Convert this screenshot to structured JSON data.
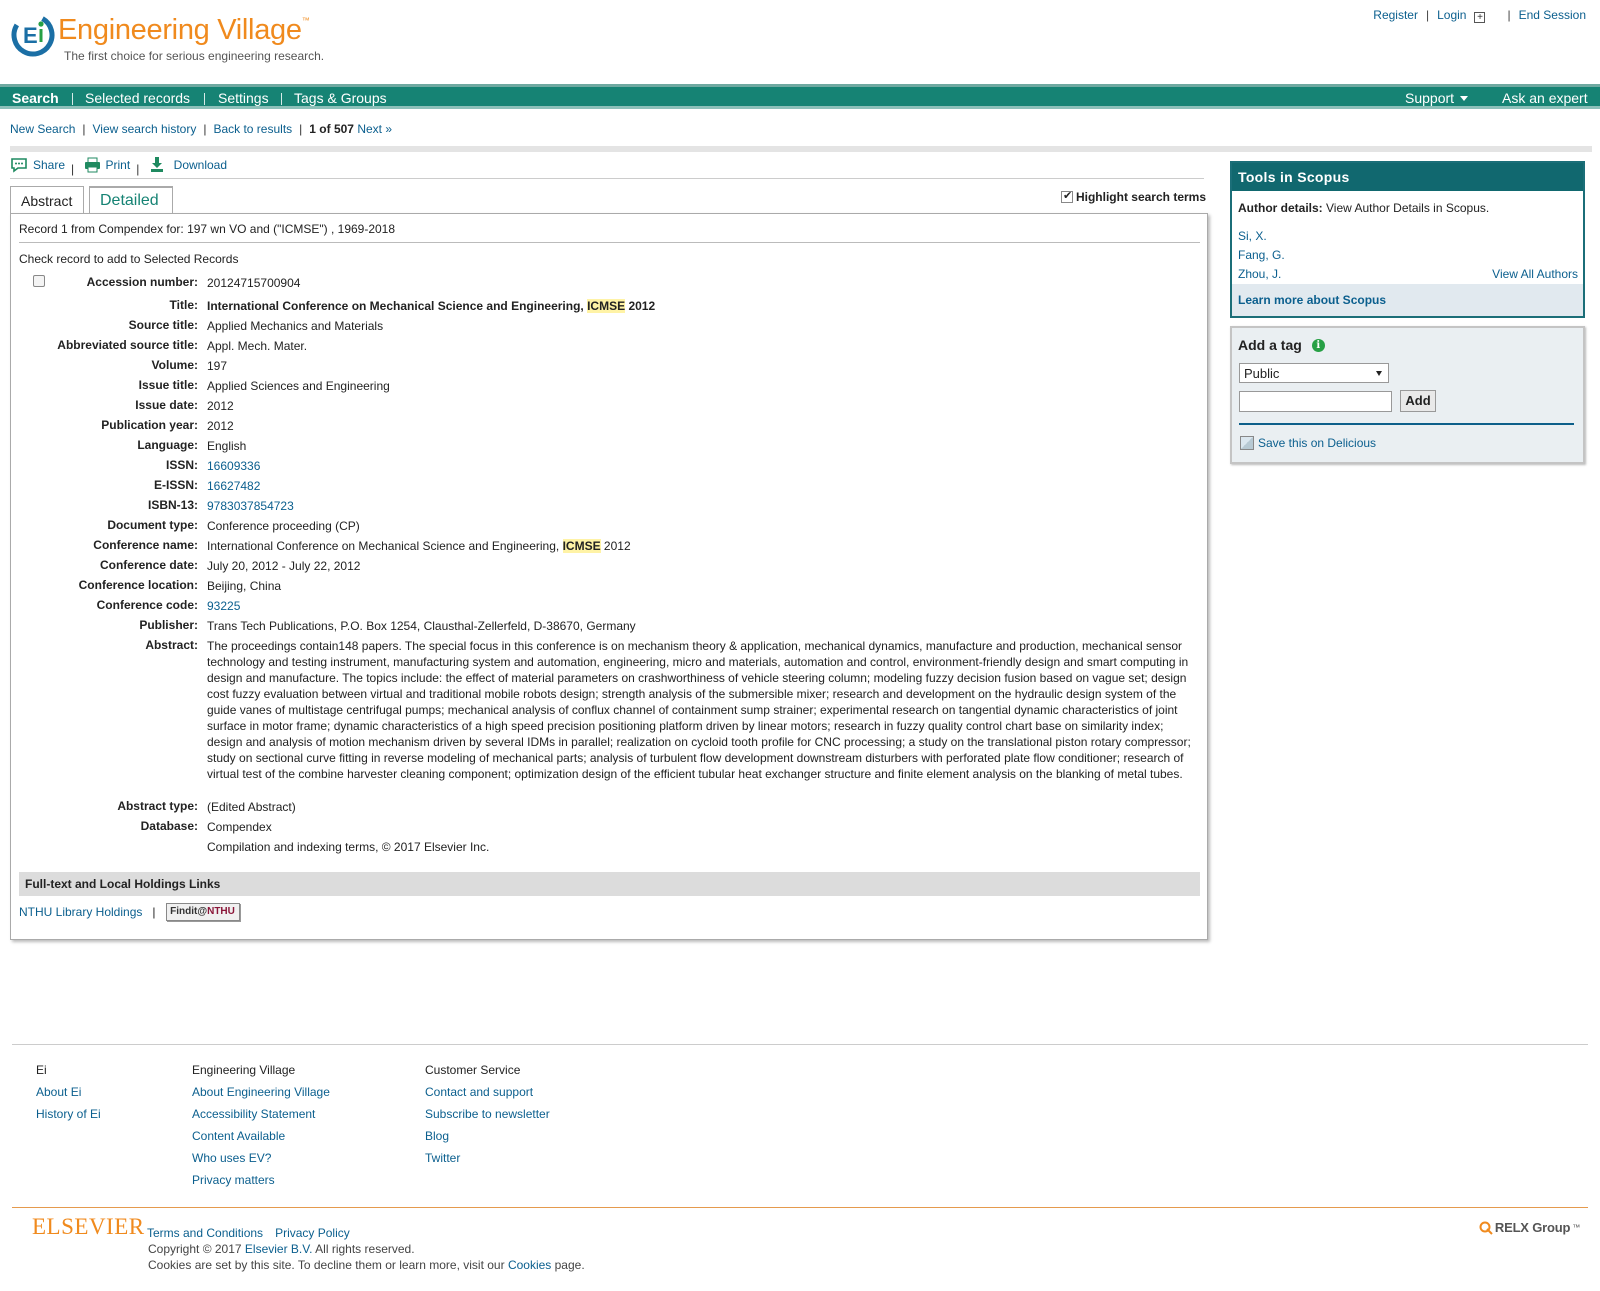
{
  "header": {
    "logo_title": "Engineering Village",
    "logo_tm": "™",
    "tagline": "The first choice for serious engineering research.",
    "links": {
      "register": "Register",
      "login": "Login",
      "end_session": "End Session"
    }
  },
  "nav": {
    "items": [
      "Search",
      "Selected records",
      "Settings",
      "Tags & Groups"
    ],
    "support": "Support",
    "ask_expert": "Ask an expert"
  },
  "breadcrumb": {
    "new_search": "New Search",
    "history": "View search history",
    "back": "Back to results",
    "position": "1 of 507",
    "next": "Next »"
  },
  "actions": {
    "share": "Share",
    "print": "Print",
    "download": "Download"
  },
  "tabs": {
    "abstract": "Abstract",
    "detailed": "Detailed"
  },
  "highlight_label": "Highlight search terms",
  "record": {
    "header": "Record 1 from Compendex for: 197 wn VO and (\"ICMSE\") , 1969-2018",
    "check_label": "Check record to add to Selected Records",
    "fields": [
      {
        "label": "Accession number:",
        "value": "20124715700904"
      },
      {
        "label": "Title:",
        "value_pre": "International Conference on Mechanical Science and Engineering, ",
        "value_hl": "ICMSE",
        "value_post": " 2012"
      },
      {
        "label": "Source title:",
        "value": "Applied Mechanics and Materials"
      },
      {
        "label": "Abbreviated source title:",
        "value": "Appl. Mech. Mater."
      },
      {
        "label": "Volume:",
        "value": "197"
      },
      {
        "label": "Issue title:",
        "value": "Applied Sciences and Engineering"
      },
      {
        "label": "Issue date:",
        "value": "2012"
      },
      {
        "label": "Publication year:",
        "value": "2012"
      },
      {
        "label": "Language:",
        "value": "English"
      },
      {
        "label": "ISSN:",
        "link": "16609336"
      },
      {
        "label": "E-ISSN:",
        "link": "16627482"
      },
      {
        "label": "ISBN-13:",
        "link": "9783037854723"
      },
      {
        "label": "Document type:",
        "value": "Conference proceeding (CP)"
      },
      {
        "label": "Conference name:",
        "value_pre": "International Conference on Mechanical Science and Engineering, ",
        "value_hl": "ICMSE",
        "value_post": " 2012"
      },
      {
        "label": "Conference date:",
        "value": "July 20, 2012 - July 22, 2012"
      },
      {
        "label": "Conference location:",
        "value": "Beijing, China"
      },
      {
        "label": "Conference code:",
        "link": "93225"
      },
      {
        "label": "Publisher:",
        "value": "Trans Tech Publications, P.O. Box 1254, Clausthal-Zellerfeld, D-38670, Germany"
      },
      {
        "label": "Abstract:",
        "value": "The proceedings contain148 papers. The special focus in this conference is on mechanism theory & application, mechanical dynamics, manufacture and production, mechanical sensor technology and testing instrument, manufacturing system and automation, engineering, micro and materials, automation and control, environment-friendly design and smart computing in design and manufacture. The topics include: the effect of material parameters on crashworthiness of vehicle steering column; modeling fuzzy decision fusion based on vague set; design cost fuzzy evaluation between virtual and traditional mobile robots design; strength analysis of the submersible mixer; research and development on the hydraulic design system of the guide vanes of multistage centrifugal pumps; mechanical analysis of conflux channel of containment sump strainer; experimental research on tangential dynamic characteristics of joint surface in motor frame; dynamic characteristics of a high speed precision positioning platform driven by linear motors; research in fuzzy quality control chart base on similarity index; design and analysis of motion mechanism driven by several IDMs in parallel; realization on cycloid tooth profile for CNC processing; a study on the translational piston rotary compressor; study on sectional curve fitting in reverse modeling of mechanical parts; analysis of turbulent flow development downstream disturbers with perforated plate flow conditioner; research of virtual test of the combine harvester cleaning component; optimization design of the efficient tubular heat exchanger structure and finite element analysis on the blanking of metal tubes."
      },
      {
        "label": "Abstract type:",
        "value": "(Edited Abstract)"
      },
      {
        "label": "Database:",
        "value": "Compendex"
      },
      {
        "label": "",
        "value": "Compilation and indexing terms, © 2017 Elsevier Inc."
      }
    ],
    "fulltext_header": "Full-text and Local Holdings Links",
    "holdings_link": "NTHU Library Holdings",
    "findit_pre": "Findit@",
    "findit_post": "NTHU"
  },
  "scopus": {
    "title": "Tools in Scopus",
    "author_details_label": "Author details:",
    "author_details_text": " View Author Details in Scopus.",
    "authors": [
      "Si, X.",
      "Fang, G.",
      "Zhou, J."
    ],
    "view_all": "View All Authors",
    "learn_more": "Learn more about Scopus"
  },
  "tag": {
    "title": "Add a tag",
    "select_value": "Public",
    "add_label": "Add",
    "delicious": "Save this on Delicious"
  },
  "footer": {
    "col1": {
      "head": "Ei",
      "links": [
        "About Ei",
        "History of Ei"
      ]
    },
    "col2": {
      "head": "Engineering Village",
      "links": [
        "About Engineering Village",
        "Accessibility Statement",
        "Content Available",
        "Who uses EV?",
        "Privacy matters"
      ]
    },
    "col3": {
      "head": "Customer Service",
      "links": [
        "Contact and support",
        "Subscribe to newsletter",
        "Blog",
        "Twitter"
      ]
    },
    "elsevier": "ELSEVIER",
    "terms": "Terms and Conditions",
    "privacy": "Privacy Policy",
    "copyright_pre": "Copyright © 2017 ",
    "copyright_link": "Elsevier B.V.",
    "copyright_post": " All rights reserved.",
    "cookies_pre": "Cookies are set by this site. To decline them or learn more, visit our ",
    "cookies_link": "Cookies",
    "cookies_post": " page.",
    "relx": "RELX Group",
    "relx_tm": "™"
  },
  "colors": {
    "nav_green": "#168374",
    "brand_orange": "#f08a1d",
    "link_blue": "#0b5f8e",
    "scopus_teal": "#11686f"
  }
}
